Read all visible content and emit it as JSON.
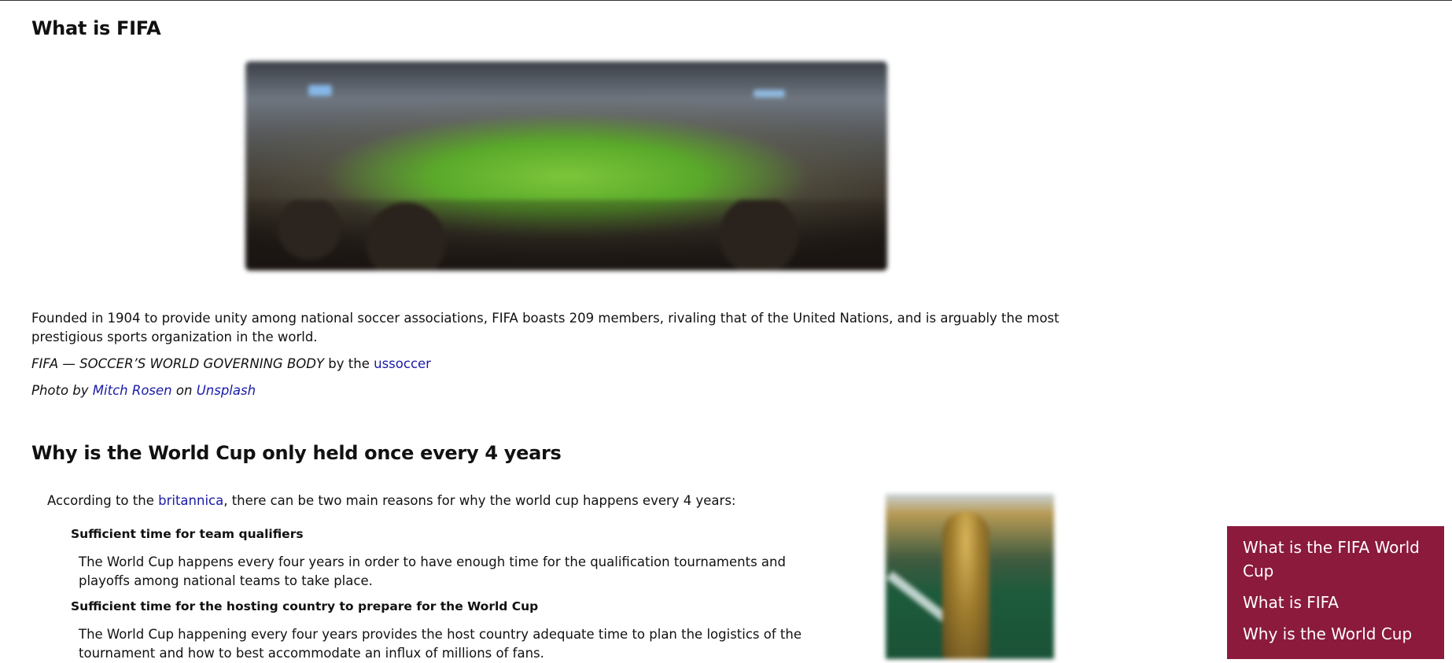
{
  "sections": {
    "fifa": {
      "heading": "What is FIFA",
      "image_alt": "Stadium panorama",
      "paragraph": "Founded in 1904 to provide unity among national soccer associations, FIFA boasts 209 members, rivaling that of the United Nations, and is arguably the most prestigious sports organization in the world.",
      "quote_source_title": "FIFA — SOCCER’S WORLD GOVERNING BODY",
      "quote_by": " by the ",
      "quote_link": "ussoccer",
      "photo_by_prefix": "Photo by ",
      "photo_author": "Mitch Rosen",
      "photo_on": " on ",
      "photo_site": "Unsplash"
    },
    "why": {
      "heading": "Why is the World Cup only held once every 4 years",
      "intro_prefix": "According to the ",
      "intro_link": "britannica",
      "intro_suffix": ", there can be two main reasons for why the world cup happens every 4 years:",
      "reasons": [
        {
          "title": "Sufficient time for team qualifiers",
          "text": "The World Cup happens every four years in order to have enough time for the qualification tournaments and playoffs among national teams to take place."
        },
        {
          "title": "Sufficient time for the hosting country to prepare for the World Cup",
          "text": "The World Cup happening every four years provides the host country adequate time to plan the logistics of the tournament and how to best accommodate an influx of millions of fans."
        }
      ]
    }
  },
  "toc": {
    "background": "#8b1a3d",
    "items": [
      "What is the FIFA World Cup",
      "What is FIFA",
      "Why is the World Cup"
    ]
  }
}
